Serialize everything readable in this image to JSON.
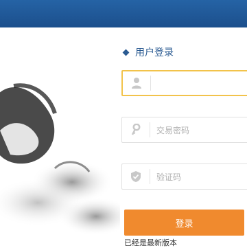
{
  "login": {
    "title": "用户登录",
    "password_placeholder": "交易密码",
    "captcha_placeholder": "验证码",
    "login_button": "登录",
    "version_text": "已经是最新版本"
  },
  "icons": {
    "user": "user-icon",
    "key": "key-icon",
    "shield": "shield-icon",
    "diamond": "diamond-icon"
  },
  "colors": {
    "header_blue": "#1f5496",
    "accent_blue": "#2b5b92",
    "focus_border": "#f2c34b",
    "button_orange": "#f08a2e"
  }
}
